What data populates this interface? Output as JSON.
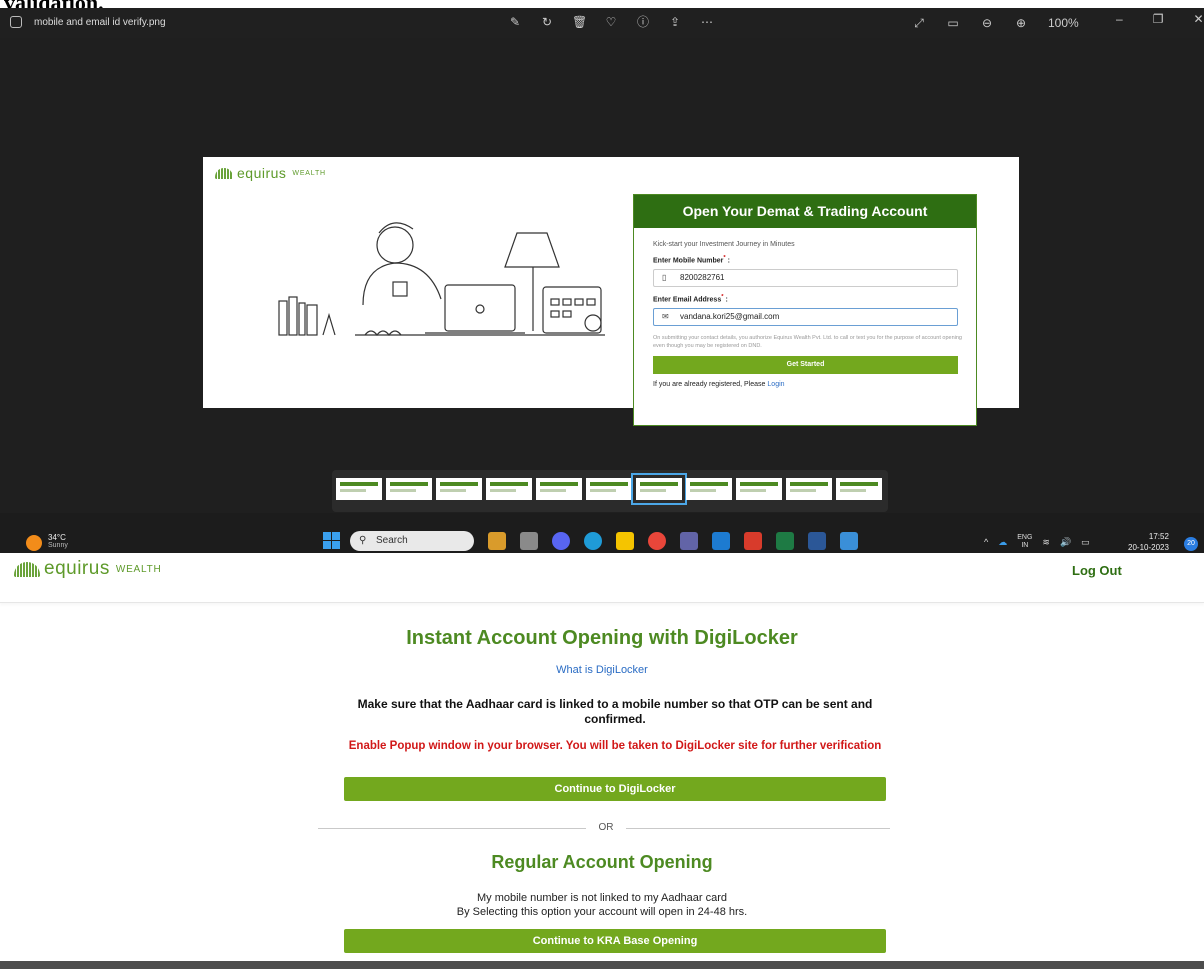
{
  "doc": {
    "heading": "validation."
  },
  "viewer": {
    "file_name": "mobile and email id verify.png",
    "zoom": "100%",
    "toolbar_icons": [
      "edit-icon",
      "rotate-icon",
      "delete-icon",
      "favorite-icon",
      "info-icon",
      "share-icon",
      "more-icon"
    ],
    "thumbnails": 11,
    "active_thumbnail": 6
  },
  "embedded": {
    "brand": "equirus",
    "brand_sub": "WEALTH",
    "form_title": "Open Your Demat & Trading Account",
    "subtitle": "Kick-start your Investment Journey in Minutes",
    "mobile_label": "Enter Mobile Number",
    "mobile_value": "8200282761",
    "email_label": "Enter Email Address",
    "email_value": "vandana.kori25@gmail.com",
    "required_mark": "*",
    "label_suffix": " :",
    "consent": "On submitting your contact details, you authorize Equirus Wealth Pvt. Ltd. to call or text you for the purpose of account opening even though you may be registered on DND.",
    "submit": "Get Started",
    "registered_text": "If you are already registered, Please ",
    "login_link": "Login"
  },
  "taskbar": {
    "temperature": "34°C",
    "condition": "Sunny",
    "search_placeholder": "Search",
    "lang_top": "ENG",
    "lang_bottom": "IN",
    "time": "17:52",
    "date": "20-10-2023",
    "notifications": "20"
  },
  "page": {
    "brand": "equirus",
    "brand_sub": "WEALTH",
    "logout": "Log Out",
    "title": "Instant Account Opening with DigiLocker",
    "what_is": "What is DigiLocker",
    "notice": "Make sure that the Aadhaar card is linked to a mobile number so that OTP can be sent and confirmed.",
    "warning": "Enable Popup window in your browser. You will be taken to DigiLocker site for further verification",
    "continue_digilocker": "Continue to DigiLocker",
    "or": "OR",
    "regular_title": "Regular Account Opening",
    "regular_line1": "My mobile number is not linked to my Aadhaar card",
    "regular_line2": "By Selecting this option your account will open in 24-48 hrs.",
    "continue_kra": "Continue to KRA Base Opening"
  },
  "colors": {
    "brand_green": "#4d8a22",
    "dark_green": "#2e6e12",
    "button_green": "#73a81e",
    "warning_red": "#d11818",
    "link_blue": "#2a6cc4"
  }
}
